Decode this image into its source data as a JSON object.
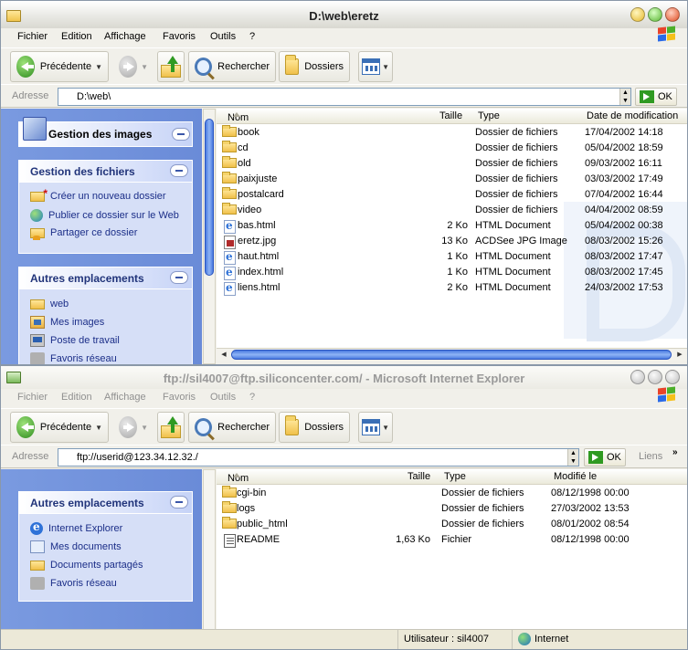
{
  "window1": {
    "title": "D:\\web\\eretz",
    "menu": [
      "Fichier",
      "Edition",
      "Affichage",
      "Favoris",
      "Outils",
      "?"
    ],
    "toolbar": {
      "back": "Précédente",
      "search": "Rechercher",
      "folders": "Dossiers"
    },
    "address_label": "Adresse",
    "address_value": "D:\\web\\",
    "go_label": "OK",
    "side": {
      "image_tasks": "Gestion des images",
      "file_tasks": {
        "title": "Gestion des fichiers",
        "items": [
          "Créer un nouveau dossier",
          "Publier ce dossier sur le Web",
          "Partager ce dossier"
        ]
      },
      "other_places": {
        "title": "Autres emplacements",
        "items": [
          "web",
          "Mes images",
          "Poste de travail",
          "Favoris réseau"
        ]
      }
    },
    "columns": {
      "name": "Nom",
      "size": "Taille",
      "type": "Type",
      "modified": "Date de modification"
    },
    "files": [
      {
        "name": "book",
        "size": "",
        "type": "Dossier de fichiers",
        "date": "17/04/2002 14:18",
        "icon": "folder"
      },
      {
        "name": "cd",
        "size": "",
        "type": "Dossier de fichiers",
        "date": "05/04/2002 18:59",
        "icon": "folder"
      },
      {
        "name": "old",
        "size": "",
        "type": "Dossier de fichiers",
        "date": "09/03/2002 16:11",
        "icon": "folder"
      },
      {
        "name": "paixjuste",
        "size": "",
        "type": "Dossier de fichiers",
        "date": "03/03/2002 17:49",
        "icon": "folder"
      },
      {
        "name": "postalcard",
        "size": "",
        "type": "Dossier de fichiers",
        "date": "07/04/2002 16:44",
        "icon": "folder"
      },
      {
        "name": "video",
        "size": "",
        "type": "Dossier de fichiers",
        "date": "04/04/2002 08:59",
        "icon": "folder"
      },
      {
        "name": "bas.html",
        "size": "2 Ko",
        "type": "HTML Document",
        "date": "05/04/2002 00:38",
        "icon": "html"
      },
      {
        "name": "eretz.jpg",
        "size": "13 Ko",
        "type": "ACDSee JPG Image",
        "date": "08/03/2002 15:26",
        "icon": "jpg"
      },
      {
        "name": "haut.html",
        "size": "1 Ko",
        "type": "HTML Document",
        "date": "08/03/2002 17:47",
        "icon": "html"
      },
      {
        "name": "index.html",
        "size": "1 Ko",
        "type": "HTML Document",
        "date": "08/03/2002 17:45",
        "icon": "html"
      },
      {
        "name": "liens.html",
        "size": "2 Ko",
        "type": "HTML Document",
        "date": "24/03/2002 17:53",
        "icon": "html"
      }
    ]
  },
  "window2": {
    "title": "ftp://sil4007@ftp.siliconcenter.com/ - Microsoft Internet Explorer",
    "menu": [
      "Fichier",
      "Edition",
      "Affichage",
      "Favoris",
      "Outils",
      "?"
    ],
    "toolbar": {
      "back": "Précédente",
      "search": "Rechercher",
      "folders": "Dossiers"
    },
    "address_label": "Adresse",
    "address_value": "ftp://userid@123.34.12.32./",
    "go_label": "OK",
    "links_label": "Liens",
    "side": {
      "other_places": {
        "title": "Autres emplacements",
        "items": [
          "Internet Explorer",
          "Mes documents",
          "Documents partagés",
          "Favoris réseau"
        ]
      }
    },
    "columns": {
      "name": "Nom",
      "size": "Taille",
      "type": "Type",
      "modified": "Modifié le"
    },
    "files": [
      {
        "name": "cgi-bin",
        "size": "",
        "type": "Dossier de fichiers",
        "date": "08/12/1998 00:00",
        "icon": "folder"
      },
      {
        "name": "logs",
        "size": "",
        "type": "Dossier de fichiers",
        "date": "27/03/2002 13:53",
        "icon": "folder"
      },
      {
        "name": "public_html",
        "size": "",
        "type": "Dossier de fichiers",
        "date": "08/01/2002 08:54",
        "icon": "folder"
      },
      {
        "name": "README",
        "size": "1,63 Ko",
        "type": "Fichier",
        "date": "08/12/1998 00:00",
        "icon": "file"
      }
    ],
    "status": {
      "user": "Utilisateur : sil4007",
      "zone": "Internet"
    }
  }
}
